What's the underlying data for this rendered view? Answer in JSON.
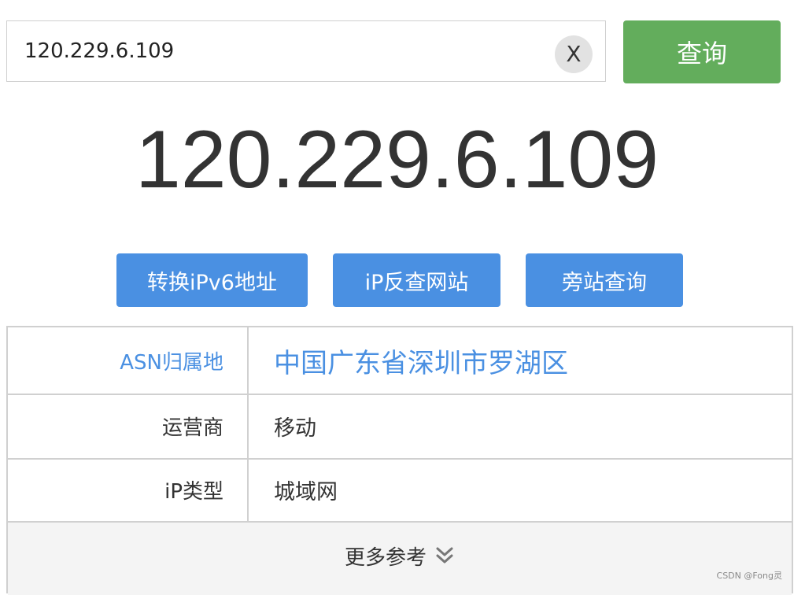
{
  "search": {
    "value": "120.229.6.109",
    "clear_label": "X",
    "query_label": "查询"
  },
  "result": {
    "ip": "120.229.6.109"
  },
  "actions": {
    "ipv6_label": "转换iPv6地址",
    "reverse_label": "iP反查网站",
    "sites_label": "旁站查询"
  },
  "info": {
    "rows": [
      {
        "label": "ASN归属地",
        "value": "中国广东省深圳市罗湖区"
      },
      {
        "label": "运营商",
        "value": "移动"
      },
      {
        "label": "iP类型",
        "value": "城域网"
      }
    ],
    "more_label": "更多参考"
  },
  "watermark": "CSDN @Fong灵",
  "colors": {
    "query_button": "#63ad5c",
    "action_button": "#4a90e2",
    "asn_text": "#4a90e2"
  },
  "icons": {
    "clear": "close-icon",
    "more": "double-chevron-down-icon"
  }
}
